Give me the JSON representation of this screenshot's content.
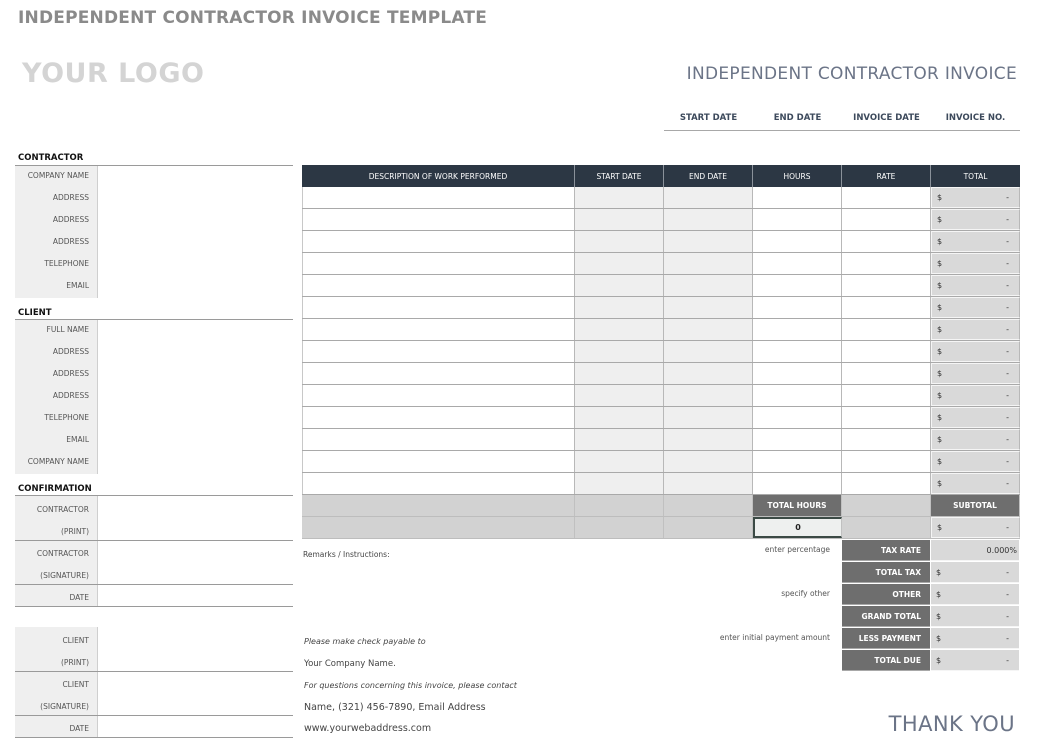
{
  "header": {
    "page_title": "INDEPENDENT CONTRACTOR INVOICE TEMPLATE",
    "logo_placeholder": "YOUR LOGO",
    "invoice_title": "INDEPENDENT CONTRACTOR INVOICE",
    "meta_columns": [
      "START DATE",
      "END DATE",
      "INVOICE DATE",
      "INVOICE NO."
    ]
  },
  "contractor": {
    "heading": "CONTRACTOR",
    "fields": [
      "COMPANY NAME",
      "ADDRESS",
      "ADDRESS",
      "ADDRESS",
      "TELEPHONE",
      "EMAIL"
    ]
  },
  "client": {
    "heading": "CLIENT",
    "fields": [
      "FULL NAME",
      "ADDRESS",
      "ADDRESS",
      "ADDRESS",
      "TELEPHONE",
      "EMAIL",
      "COMPANY NAME"
    ]
  },
  "confirmation": {
    "heading": "CONFIRMATION",
    "contractor_print": [
      "CONTRACTOR",
      "(PRINT)"
    ],
    "contractor_signature": [
      "CONTRACTOR",
      "(SIGNATURE)"
    ],
    "contractor_date": "DATE",
    "client_print": [
      "CLIENT",
      "(PRINT)"
    ],
    "client_signature": [
      "CLIENT",
      "(SIGNATURE)"
    ],
    "client_date": "DATE"
  },
  "table": {
    "columns": [
      "DESCRIPTION OF WORK PERFORMED",
      "START DATE",
      "END DATE",
      "HOURS",
      "RATE",
      "TOTAL"
    ],
    "currency": "$",
    "empty_value": "-",
    "row_count": 14,
    "total_hours_label": "TOTAL HOURS",
    "total_hours_value": "0",
    "subtotal_label": "SUBTOTAL",
    "subtotal_value": "-"
  },
  "summary": {
    "hints": {
      "tax_rate": "enter percentage",
      "other": "specify other",
      "less_payment": "enter initial payment amount"
    },
    "rows": [
      {
        "label": "TAX RATE",
        "currency": "",
        "value": "0.000%"
      },
      {
        "label": "TOTAL TAX",
        "currency": "$",
        "value": "-"
      },
      {
        "label": "OTHER",
        "currency": "$",
        "value": "-"
      },
      {
        "label": "GRAND TOTAL",
        "currency": "$",
        "value": "-"
      },
      {
        "label": "LESS PAYMENT",
        "currency": "$",
        "value": "-"
      },
      {
        "label": "TOTAL DUE",
        "currency": "$",
        "value": "-"
      }
    ]
  },
  "remarks_label": "Remarks / Instructions:",
  "footer": {
    "payable_note": "Please make check payable to",
    "company_name": "Your Company Name.",
    "questions_note": "For questions concerning this invoice, please contact",
    "contact": "Name, (321) 456-7890, Email Address",
    "website": "www.yourwebaddress.com",
    "thanks": "THANK YOU"
  }
}
